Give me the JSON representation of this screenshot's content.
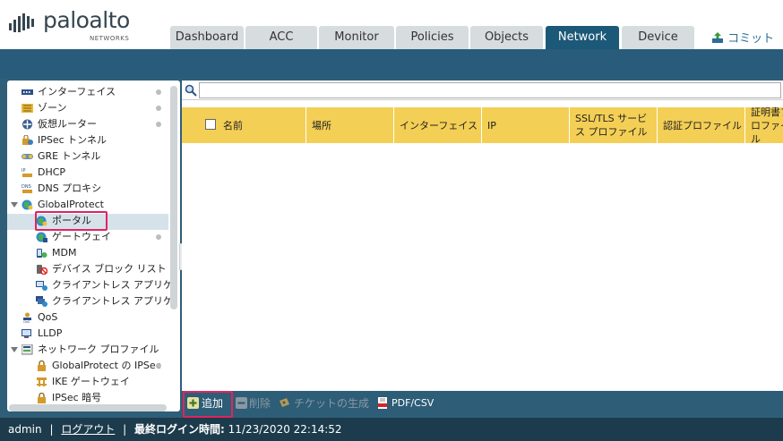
{
  "brand": {
    "name": "paloalto",
    "sub": "NETWORKS"
  },
  "tabs": [
    {
      "label": "Dashboard"
    },
    {
      "label": "ACC"
    },
    {
      "label": "Monitor"
    },
    {
      "label": "Policies"
    },
    {
      "label": "Objects"
    },
    {
      "label": "Network",
      "active": true
    },
    {
      "label": "Device"
    }
  ],
  "commit_label": "コミット",
  "tree": {
    "items": [
      {
        "label": "インターフェイス",
        "icon": "interface-icon"
      },
      {
        "label": "ゾーン",
        "icon": "zone-icon"
      },
      {
        "label": "仮想ルーター",
        "icon": "virtual-router-icon"
      },
      {
        "label": "IPSec トンネル",
        "icon": "ipsec-tunnel-icon"
      },
      {
        "label": "GRE トンネル",
        "icon": "gre-tunnel-icon"
      },
      {
        "label": "DHCP",
        "icon": "dhcp-icon"
      },
      {
        "label": "DNS プロキシ",
        "icon": "dns-proxy-icon"
      },
      {
        "label": "GlobalProtect",
        "icon": "globalprotect-icon"
      },
      {
        "label": "ポータル",
        "icon": "portal-icon",
        "selected": true
      },
      {
        "label": "ゲートウェイ",
        "icon": "gateway-icon"
      },
      {
        "label": "MDM",
        "icon": "mdm-icon"
      },
      {
        "label": "デバイス ブロック リスト",
        "icon": "device-block-list-icon"
      },
      {
        "label": "クライアントレス アプリケ",
        "icon": "clientless-app-icon"
      },
      {
        "label": "クライアントレス アプリケ",
        "icon": "clientless-app-group-icon"
      },
      {
        "label": "QoS",
        "icon": "qos-icon"
      },
      {
        "label": "LLDP",
        "icon": "lldp-icon"
      },
      {
        "label": "ネットワーク プロファイル",
        "icon": "network-profiles-icon"
      },
      {
        "label": "GlobalProtect の IPSec",
        "icon": "lock-icon"
      },
      {
        "label": "IKE ゲートウェイ",
        "icon": "ike-gateway-icon"
      },
      {
        "label": "IPSec 暗号",
        "icon": "lock-icon"
      }
    ]
  },
  "table": {
    "search_placeholder": "",
    "columns": [
      "名前",
      "場所",
      "インターフェイス",
      "IP",
      "SSL/TLS サービス プロファイル",
      "認証プロファイル",
      "証明書プロファイル"
    ],
    "rows": []
  },
  "toolbar": {
    "add": "追加",
    "delete": "削除",
    "ticket": "チケットの生成",
    "pdf": "PDF/CSV"
  },
  "status": {
    "user": "admin",
    "logout": "ログアウト",
    "last_login_label": "最終ログイン時間:",
    "last_login": "11/23/2020 22:14:52"
  },
  "colors": {
    "accent": "#1c5878",
    "header_row": "#f4cf55",
    "highlight": "#e0245e"
  }
}
